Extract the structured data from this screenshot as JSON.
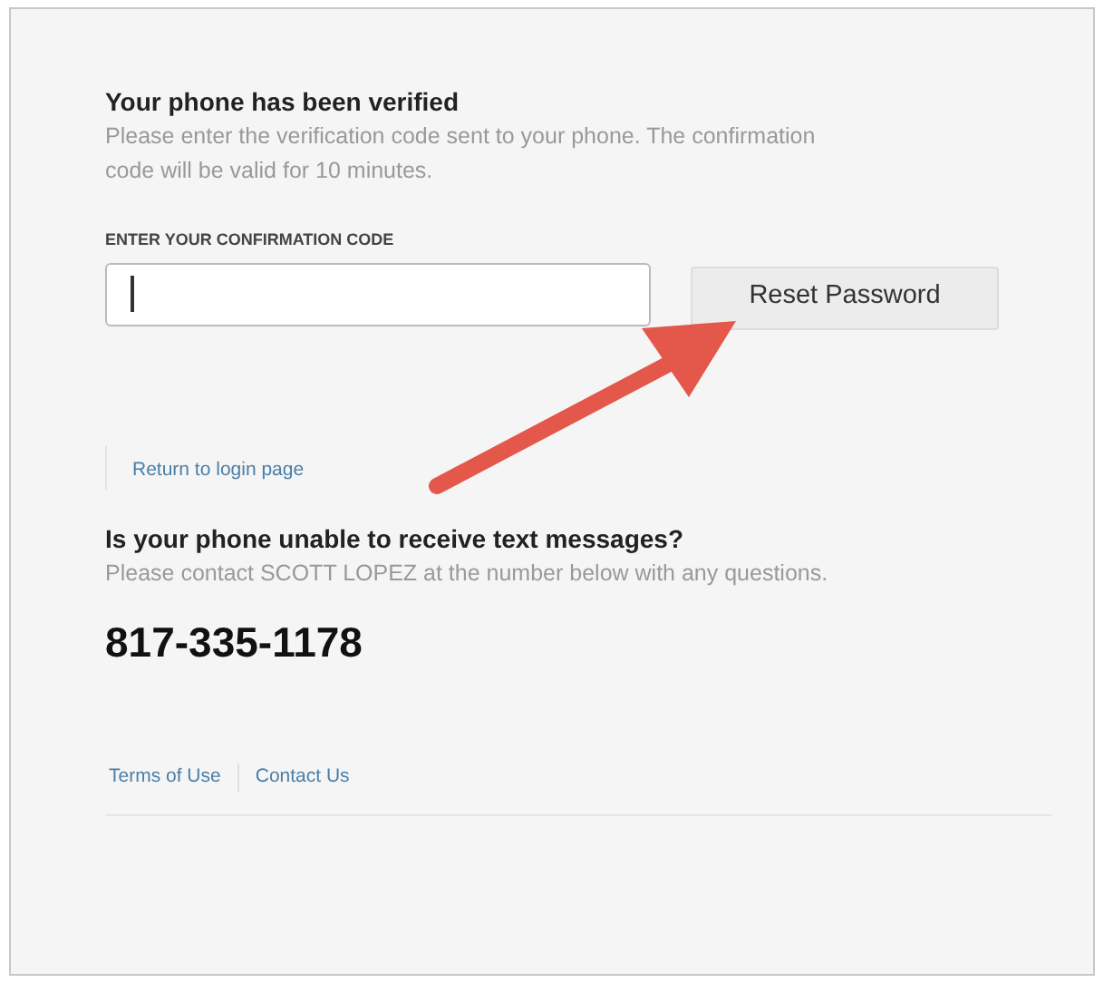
{
  "heading": "Your phone has been verified",
  "description": "Please enter the verification code sent to your phone. The confirmation code will be valid for 10 minutes.",
  "code_field": {
    "label": "ENTER YOUR CONFIRMATION CODE"
  },
  "reset_button": "Reset Password",
  "return_link": "Return to login page",
  "help_heading": "Is your phone unable to receive text messages?",
  "help_text": "Please contact SCOTT LOPEZ at the number below with any questions.",
  "phone_number": "817-335-1178",
  "footer_links": [
    "Terms of Use",
    "Contact Us"
  ]
}
